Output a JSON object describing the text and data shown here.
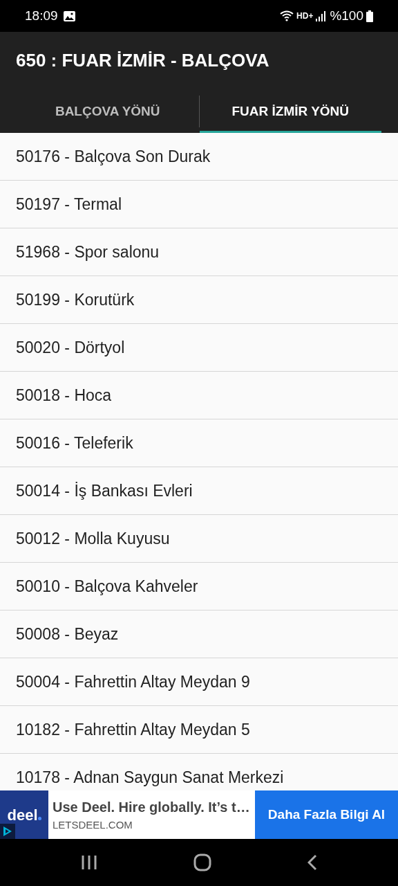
{
  "status_bar": {
    "time": "18:09",
    "network": "HD+",
    "battery": "%100"
  },
  "app_bar": {
    "title": "650 : FUAR İZMİR - BALÇOVA"
  },
  "tabs": [
    {
      "label": "BALÇOVA YÖNÜ",
      "selected": false
    },
    {
      "label": "FUAR İZMİR YÖNÜ",
      "selected": true
    }
  ],
  "stops": [
    {
      "label": "50176 - Balçova Son Durak"
    },
    {
      "label": "50197 - Termal"
    },
    {
      "label": "51968 - Spor salonu"
    },
    {
      "label": "50199 - Korutürk"
    },
    {
      "label": "50020 - Dörtyol"
    },
    {
      "label": "50018 - Hoca"
    },
    {
      "label": "50016 - Teleferik"
    },
    {
      "label": "50014 - İş Bankası Evleri"
    },
    {
      "label": "50012 - Molla Kuyusu"
    },
    {
      "label": "50010 - Balçova Kahveler"
    },
    {
      "label": "50008 - Beyaz"
    },
    {
      "label": "50004 - Fahrettin Altay Meydan 9"
    },
    {
      "label": "10182 - Fahrettin Altay Meydan 5"
    },
    {
      "label": "10178 - Adnan Saygun Sanat Merkezi"
    }
  ],
  "ad": {
    "logo": "deel",
    "headline": "Use Deel. Hire globally. It’s t…",
    "domain": "LETSDEEL.COM",
    "button": "Daha Fazla Bilgi Al"
  }
}
